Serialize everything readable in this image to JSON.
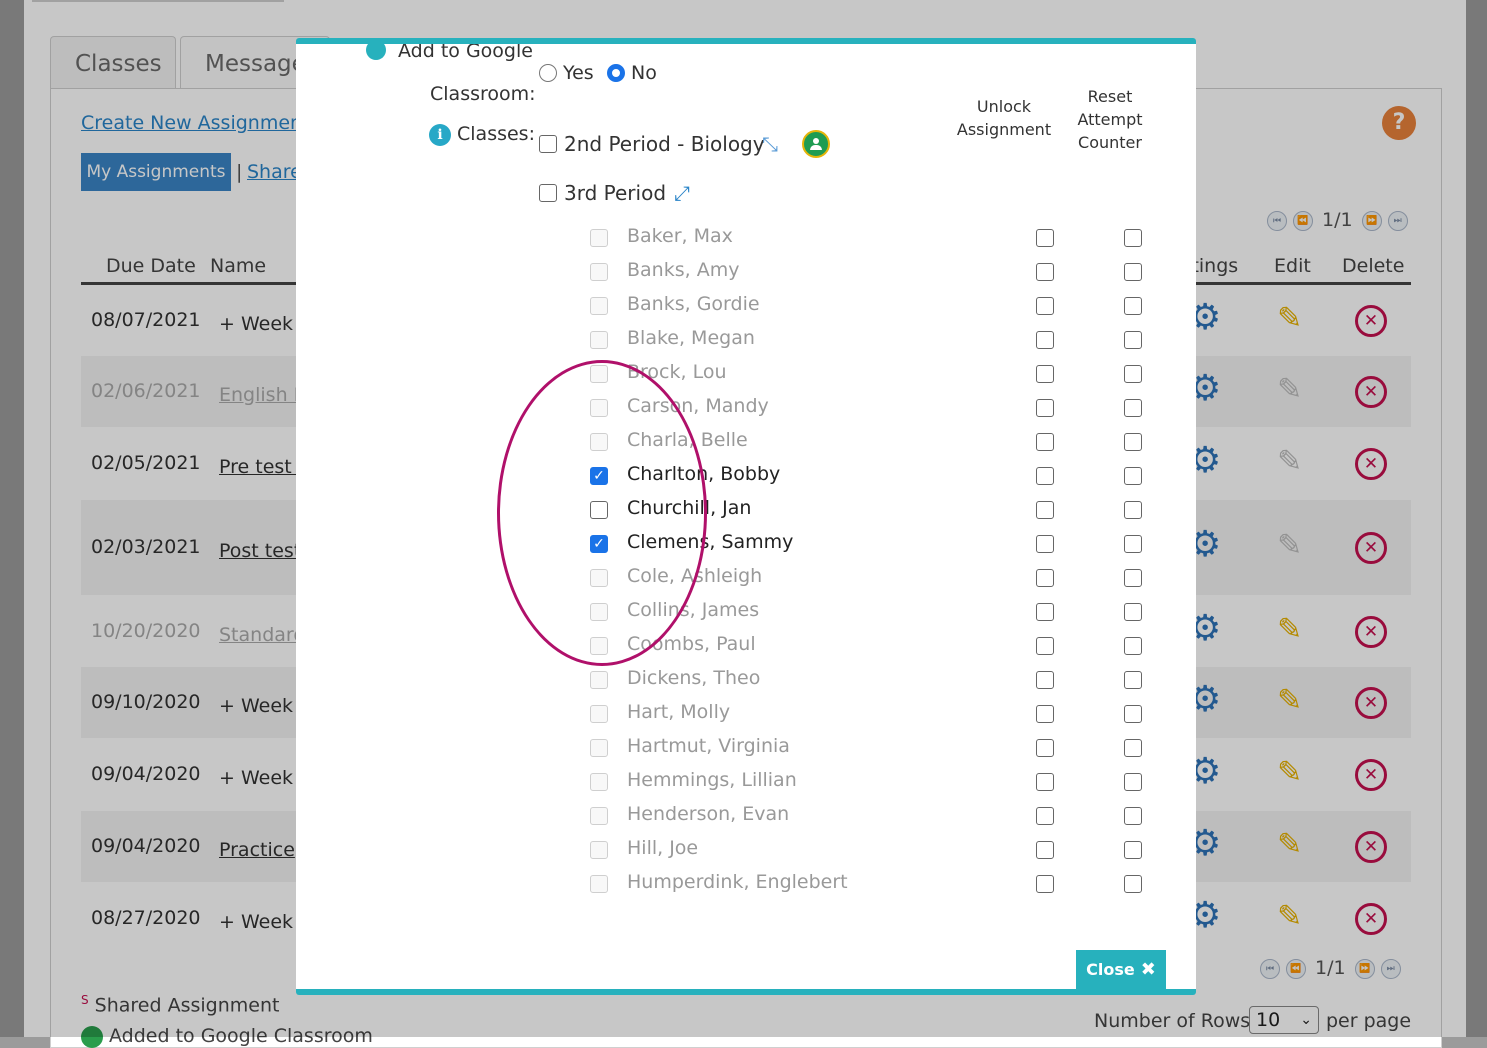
{
  "background": {
    "tabs": [
      "Classes",
      "Message"
    ],
    "create_link": "Create New Assignment",
    "my_assignments": "My Assignments",
    "separator": "|",
    "shared_link": "Share",
    "help": "?",
    "pager": {
      "first": "⏮",
      "prev": "⏪",
      "page": "1/1",
      "next": "⏩",
      "last": "⏭"
    },
    "headers": {
      "due_date": "Due Date",
      "name": "Name",
      "settings": "ttings",
      "edit": "Edit",
      "delete": "Delete"
    },
    "rows": [
      {
        "date": "08/07/2021",
        "name": "+ Week"
      },
      {
        "date": "02/06/2021",
        "name": "English I"
      },
      {
        "date": "02/05/2021",
        "name": "Pre test -"
      },
      {
        "date": "02/03/2021",
        "name": "Post test"
      },
      {
        "date": "10/20/2020",
        "name": "Standard"
      },
      {
        "date": "09/10/2020",
        "name": "+ Week"
      },
      {
        "date": "09/04/2020",
        "name": "+ Week"
      },
      {
        "date": "09/04/2020",
        "name": "Practice"
      },
      {
        "date": "08/27/2020",
        "name": "+ Week"
      }
    ],
    "shared_note": {
      "mark": "S",
      "text": "Shared Assignment"
    },
    "gc_note": "Added to Google Classroom",
    "rows_label": "Number of Rows",
    "rows_value": "10",
    "per_page": "per page",
    "icons": {
      "settings": "gear-icon",
      "edit": "pencil-icon",
      "delete": "close-circle-icon"
    }
  },
  "modal": {
    "gc_label_cut": "Add to Google",
    "classroom_label": "Classroom:",
    "yes_label": "Yes",
    "no_label": "No",
    "selected_option": "No",
    "info_icon": "i",
    "classes_label": "Classes:",
    "class1": {
      "label": "2nd Period - Biology",
      "checked": false
    },
    "class2": {
      "label": "3rd Period",
      "checked": false
    },
    "unlock_head": "Unlock Assignment",
    "reset_head": "Reset Attempt Counter",
    "students": [
      {
        "name": "Baker, Max",
        "enabled": false,
        "checked": false
      },
      {
        "name": "Banks, Amy",
        "enabled": false,
        "checked": false
      },
      {
        "name": "Banks, Gordie",
        "enabled": false,
        "checked": false
      },
      {
        "name": "Blake, Megan",
        "enabled": false,
        "checked": false
      },
      {
        "name": "Brock, Lou",
        "enabled": false,
        "checked": false
      },
      {
        "name": "Carson, Mandy",
        "enabled": false,
        "checked": false
      },
      {
        "name": "Charla, Belle",
        "enabled": false,
        "checked": false
      },
      {
        "name": "Charlton, Bobby",
        "enabled": true,
        "checked": true
      },
      {
        "name": "Churchill, Jan",
        "enabled": true,
        "checked": false
      },
      {
        "name": "Clemens, Sammy",
        "enabled": true,
        "checked": true
      },
      {
        "name": "Cole, Ashleigh",
        "enabled": false,
        "checked": false
      },
      {
        "name": "Collins, James",
        "enabled": false,
        "checked": false
      },
      {
        "name": "Coombs, Paul",
        "enabled": false,
        "checked": false
      },
      {
        "name": "Dickens, Theo",
        "enabled": false,
        "checked": false
      },
      {
        "name": "Hart, Molly",
        "enabled": false,
        "checked": false
      },
      {
        "name": "Hartmut, Virginia",
        "enabled": false,
        "checked": false
      },
      {
        "name": "Hemmings, Lillian",
        "enabled": false,
        "checked": false
      },
      {
        "name": "Henderson, Evan",
        "enabled": false,
        "checked": false
      },
      {
        "name": "Hill, Joe",
        "enabled": false,
        "checked": false
      },
      {
        "name": "Humperdink, Englebert",
        "enabled": false,
        "checked": false
      }
    ],
    "close_label": "Close",
    "close_icon": "✖"
  },
  "colors": {
    "accent": "#27b1bd",
    "checkbox": "#1a73e8",
    "annotation": "#b0106a",
    "link": "#2a84c8"
  }
}
